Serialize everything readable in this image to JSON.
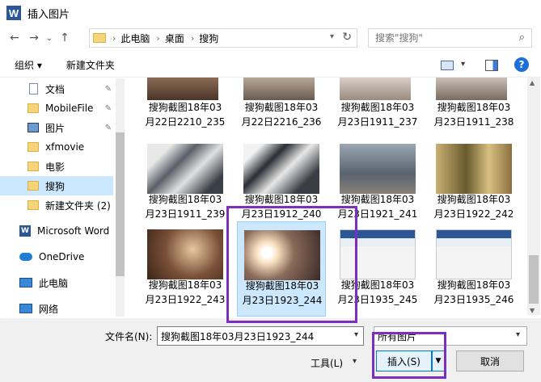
{
  "window": {
    "title": "插入图片",
    "app_icon": "W"
  },
  "nav": {
    "back_icon": "←",
    "forward_icon": "→",
    "recent_icon": "⌄",
    "up_icon": "↑",
    "breadcrumb": [
      "此电脑",
      "桌面",
      "搜狗"
    ],
    "search_placeholder": "搜索\"搜狗\""
  },
  "toolbar": {
    "organize_label": "组织 ▾",
    "new_folder_label": "新建文件夹",
    "help_label": "?"
  },
  "sidebar": {
    "items": [
      {
        "label": "文档",
        "icon": "document-icon",
        "pinned": true
      },
      {
        "label": "MobileFile",
        "icon": "folder-icon",
        "pinned": true
      },
      {
        "label": "图片",
        "icon": "pictures-icon",
        "pinned": true
      },
      {
        "label": "xfmovie",
        "icon": "folder-icon",
        "pinned": false
      },
      {
        "label": "电影",
        "icon": "folder-icon",
        "pinned": false
      },
      {
        "label": "搜狗",
        "icon": "folder-icon",
        "pinned": false,
        "selected": true
      },
      {
        "label": "新建文件夹 (2)",
        "icon": "folder-icon",
        "pinned": false
      },
      {
        "label": "Microsoft Word",
        "icon": "word-icon",
        "pinned": false
      },
      {
        "label": "OneDrive",
        "icon": "onedrive-icon",
        "pinned": false
      },
      {
        "label": "此电脑",
        "icon": "this-pc-icon",
        "pinned": false
      },
      {
        "label": "网络",
        "icon": "network-icon",
        "pinned": false
      }
    ]
  },
  "files": {
    "row1": [
      {
        "line1": "搜狗截图18年03",
        "line2": "月22日2210_235"
      },
      {
        "line1": "搜狗截图18年03",
        "line2": "月22日2216_236"
      },
      {
        "line1": "搜狗截图18年03",
        "line2": "月23日1911_237"
      },
      {
        "line1": "搜狗截图18年03",
        "line2": "月23日1911_238"
      }
    ],
    "row2": [
      {
        "line1": "搜狗截图18年03",
        "line2": "月23日1911_239"
      },
      {
        "line1": "搜狗截图18年03",
        "line2": "月23日1912_240"
      },
      {
        "line1": "搜狗截图18年03",
        "line2": "月23日1921_241"
      },
      {
        "line1": "搜狗截图18年03",
        "line2": "月23日1922_242"
      }
    ],
    "row3": [
      {
        "line1": "搜狗截图18年03",
        "line2": "月23日1922_243"
      },
      {
        "line1": "搜狗截图18年03",
        "line2": "月23日1923_244",
        "selected": true
      },
      {
        "line1": "搜狗截图18年03",
        "line2": "月23日1935_245"
      },
      {
        "line1": "搜狗截图18年03",
        "line2": "月23日1935_246"
      }
    ]
  },
  "footer": {
    "filename_label": "文件名(N):",
    "filename_value": "搜狗截图18年03月23日1923_244",
    "filetype_value": "所有图片",
    "tools_label": "工具(L)",
    "insert_label": "插入(S)",
    "cancel_label": "取消"
  },
  "colors": {
    "selection": "#cce8ff",
    "accent": "#0078d7",
    "highlight": "#7b2fbe"
  }
}
